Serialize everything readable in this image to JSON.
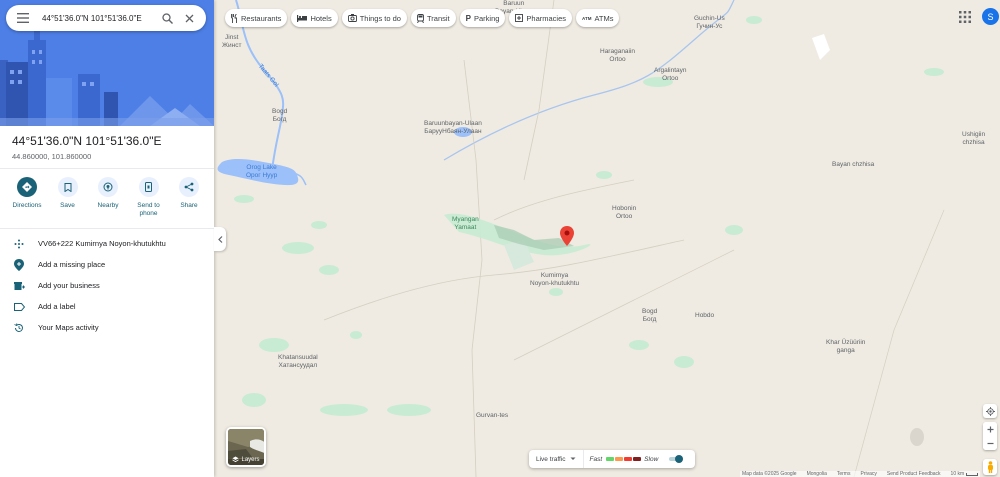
{
  "search": {
    "query": "44°51'36.0\"N 101°51'36.0\"E"
  },
  "place": {
    "title": "44°51'36.0\"N 101°51'36.0\"E",
    "coords": "44.860000, 101.860000"
  },
  "actions": [
    {
      "label": "Directions",
      "icon": "directions-icon"
    },
    {
      "label": "Save",
      "icon": "bookmark-icon"
    },
    {
      "label": "Nearby",
      "icon": "nearby-icon"
    },
    {
      "label": "Send to phone",
      "icon": "phone-icon"
    },
    {
      "label": "Share",
      "icon": "share-icon"
    }
  ],
  "info": [
    {
      "text": "VV66+222 Kumirnya Noyon-khutukhtu",
      "icon": "plus-code-icon"
    },
    {
      "text": "Add a missing place",
      "icon": "add-place-icon"
    },
    {
      "text": "Add your business",
      "icon": "business-icon"
    },
    {
      "text": "Add a label",
      "icon": "label-icon"
    },
    {
      "text": "Your Maps activity",
      "icon": "history-icon"
    }
  ],
  "chips": [
    {
      "label": "Restaurants",
      "icon": "restaurant-icon"
    },
    {
      "label": "Hotels",
      "icon": "hotel-icon"
    },
    {
      "label": "Things to do",
      "icon": "camera-icon"
    },
    {
      "label": "Transit",
      "icon": "transit-icon"
    },
    {
      "label": "Parking",
      "icon": "parking-icon"
    },
    {
      "label": "Pharmacies",
      "icon": "pharmacy-icon"
    },
    {
      "label": "ATMs",
      "icon": "atm-icon"
    }
  ],
  "user": {
    "initial": "S"
  },
  "layers": {
    "label": "Layers"
  },
  "traffic": {
    "live_label": "Live traffic",
    "fast": "Fast",
    "slow": "Slow"
  },
  "colors": {
    "accent": "#1a6277",
    "traffic_fast": "#63d668",
    "traffic_mid": "#ff974d",
    "traffic_slow1": "#f23c32",
    "traffic_slow2": "#811f1f",
    "pin": "#ea4335",
    "water": "#9cc0f9",
    "land": "#efebe2",
    "park": "#c8ebd4"
  },
  "places": [
    {
      "name": "Baruun\nBayan-Ulaan",
      "kind": "normal"
    },
    {
      "name": "Guchin-Us\nГучин-Ус",
      "kind": "normal"
    },
    {
      "name": "Jinst\nЖинст",
      "kind": "normal"
    },
    {
      "name": "Haraganaiin\nOrtoo",
      "kind": "normal"
    },
    {
      "name": "Argalintayn\nOrtoo",
      "kind": "normal"
    },
    {
      "name": "Taats Gol",
      "kind": "water"
    },
    {
      "name": "Bogd\nБогд",
      "kind": "normal"
    },
    {
      "name": "Baruunbayan-Ulaan\nБарууНбаян-Улаан",
      "kind": "normal"
    },
    {
      "name": "Ushigiin\nchzhisa",
      "kind": "normal"
    },
    {
      "name": "Orog Lake\nОрог Нуур",
      "kind": "water"
    },
    {
      "name": "Bayan chzhisa",
      "kind": "normal"
    },
    {
      "name": "Myangan\nYamaat",
      "kind": "green"
    },
    {
      "name": "Hobonin\nOrtoo",
      "kind": "normal"
    },
    {
      "name": "Kumirnya\nNoyon-khutukhtu",
      "kind": "normal"
    },
    {
      "name": "Bogd\nБогд",
      "kind": "normal"
    },
    {
      "name": "Hobdo",
      "kind": "normal"
    },
    {
      "name": "Khar Üzüüriin\nganga",
      "kind": "normal"
    },
    {
      "name": "Khatansuudal\nХатансуудал",
      "kind": "normal"
    },
    {
      "name": "Gurvan-tes",
      "kind": "normal"
    }
  ],
  "footer": {
    "data": "Map data ©2025 Google",
    "region": "Mongolia",
    "terms": "Terms",
    "privacy": "Privacy",
    "feedback": "Send Product Feedback",
    "scale": "10 km"
  }
}
